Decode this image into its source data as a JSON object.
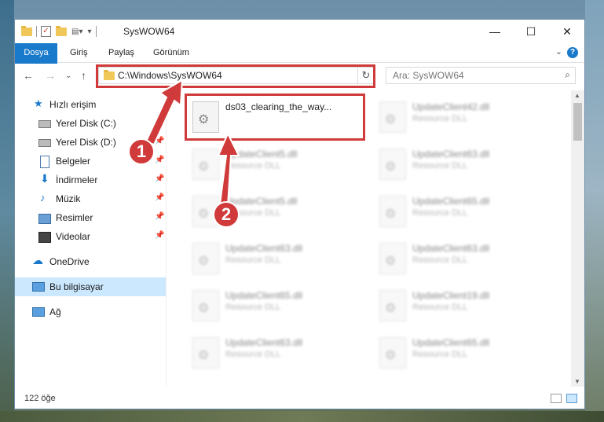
{
  "window": {
    "title": "SysWOW64",
    "controls": {
      "minimize": "—",
      "maximize": "☐",
      "close": "✕"
    }
  },
  "ribbon": {
    "tabs": [
      "Dosya",
      "Giriş",
      "Paylaş",
      "Görünüm"
    ],
    "help": "?"
  },
  "navigation": {
    "address": "C:\\Windows\\SysWOW64",
    "search_placeholder": "Ara: SysWOW64"
  },
  "sidebar": {
    "quick_access": "Hızlı erişim",
    "items": [
      {
        "label": "Yerel Disk (C:)",
        "pinned": true
      },
      {
        "label": "Yerel Disk (D:)",
        "pinned": true
      },
      {
        "label": "Belgeler",
        "pinned": true
      },
      {
        "label": "İndirmeler",
        "pinned": true
      },
      {
        "label": "Müzik",
        "pinned": true
      },
      {
        "label": "Resimler",
        "pinned": true
      },
      {
        "label": "Videolar",
        "pinned": true
      }
    ],
    "onedrive": "OneDrive",
    "this_pc": "Bu bilgisayar",
    "network": "Ağ"
  },
  "files": [
    {
      "name": "ds03_clearing_the_way...",
      "type": ""
    },
    {
      "name": "UpdateClient42.dll",
      "type": "Resource DLL"
    },
    {
      "name": "UpdateClient5.dll",
      "type": "Resource DLL"
    },
    {
      "name": "UpdateClient63.dll",
      "type": "Resource DLL"
    },
    {
      "name": "UpdateClient5.dll",
      "type": "Resource DLL"
    },
    {
      "name": "UpdateClient65.dll",
      "type": "Resource DLL"
    },
    {
      "name": "UpdateClient63.dll",
      "type": "Resource DLL"
    },
    {
      "name": "UpdateClient63.dll",
      "type": "Resource DLL"
    },
    {
      "name": "UpdateClient65.dll",
      "type": "Resource DLL"
    },
    {
      "name": "UpdateClient19.dll",
      "type": "Resource DLL"
    },
    {
      "name": "UpdateClient63.dll",
      "type": "Resource DLL"
    },
    {
      "name": "UpdateClient65.dll",
      "type": "Resource DLL"
    }
  ],
  "status": {
    "item_count": "122 öğe"
  },
  "callouts": {
    "one": "1",
    "two": "2"
  },
  "colors": {
    "accent": "#1979ca",
    "highlight": "#d03a3a",
    "selection": "#cce8ff"
  }
}
